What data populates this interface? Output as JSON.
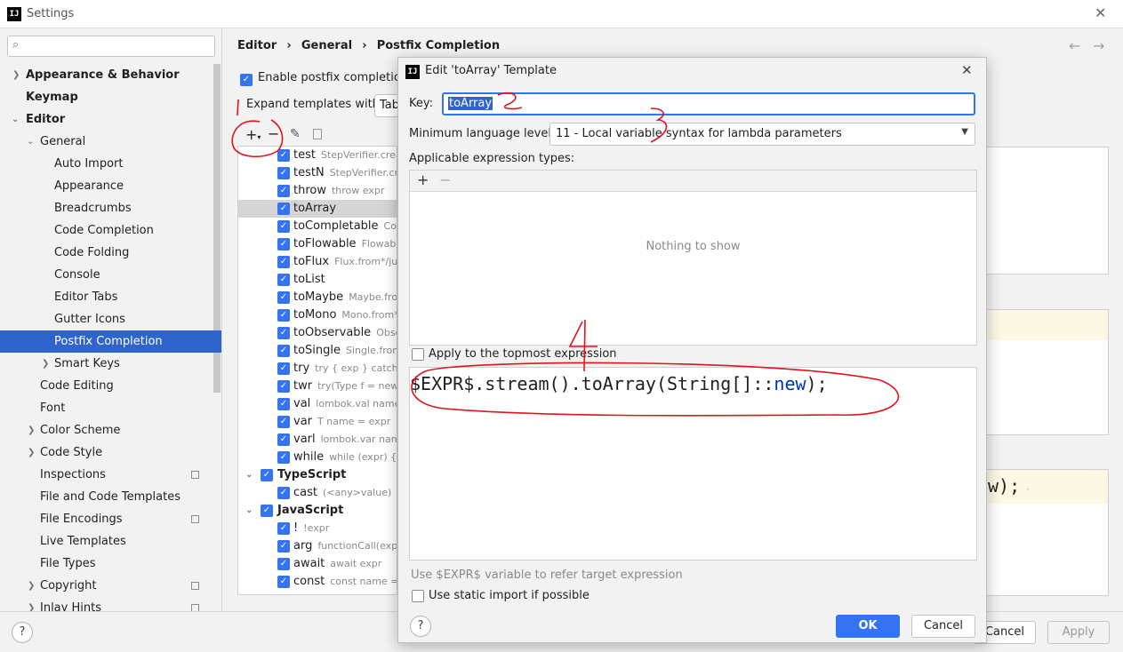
{
  "window": {
    "title": "Settings",
    "app_icon": "IJ"
  },
  "search": {
    "placeholder": ""
  },
  "sidebar": {
    "items": [
      {
        "label": "Appearance & Behavior"
      },
      {
        "label": "Keymap"
      },
      {
        "label": "Editor"
      },
      {
        "label": "General"
      },
      {
        "label": "Auto Import"
      },
      {
        "label": "Appearance"
      },
      {
        "label": "Breadcrumbs"
      },
      {
        "label": "Code Completion"
      },
      {
        "label": "Code Folding"
      },
      {
        "label": "Console"
      },
      {
        "label": "Editor Tabs"
      },
      {
        "label": "Gutter Icons"
      },
      {
        "label": "Postfix Completion"
      },
      {
        "label": "Smart Keys"
      },
      {
        "label": "Code Editing"
      },
      {
        "label": "Font"
      },
      {
        "label": "Color Scheme"
      },
      {
        "label": "Code Style"
      },
      {
        "label": "Inspections"
      },
      {
        "label": "File and Code Templates"
      },
      {
        "label": "File Encodings"
      },
      {
        "label": "Live Templates"
      },
      {
        "label": "File Types"
      },
      {
        "label": "Copyright"
      },
      {
        "label": "Inlay Hints"
      }
    ]
  },
  "breadcrumb": {
    "a": "Editor",
    "sep": "›",
    "b": "General",
    "c": "Postfix Completion"
  },
  "main": {
    "enable_label": "Enable postfix completion",
    "expand_label": "Expand templates with",
    "expand_value": "Tab",
    "preview_code_tail": "w);"
  },
  "templates": [
    {
      "key": "test",
      "desc": "StepVerifier.create"
    },
    {
      "key": "testN",
      "desc": "StepVerifier.create"
    },
    {
      "key": "throw",
      "desc": "throw expr"
    },
    {
      "key": "toArray",
      "desc": ""
    },
    {
      "key": "toCompletable",
      "desc": "Completable"
    },
    {
      "key": "toFlowable",
      "desc": "Flowable"
    },
    {
      "key": "toFlux",
      "desc": "Flux.from*/just"
    },
    {
      "key": "toList",
      "desc": ""
    },
    {
      "key": "toMaybe",
      "desc": "Maybe.from"
    },
    {
      "key": "toMono",
      "desc": "Mono.from*"
    },
    {
      "key": "toObservable",
      "desc": "Observable"
    },
    {
      "key": "toSingle",
      "desc": "Single.from*"
    },
    {
      "key": "try",
      "desc": "try { exp } catch(Ex"
    },
    {
      "key": "twr",
      "desc": "try(Type f = new T"
    },
    {
      "key": "val",
      "desc": "lombok.val name ="
    },
    {
      "key": "var",
      "desc": "T name = expr"
    },
    {
      "key": "varl",
      "desc": "lombok.var name"
    },
    {
      "key": "while",
      "desc": "while (expr) {}"
    },
    {
      "key": "TypeScript",
      "desc": "",
      "group": true
    },
    {
      "key": "cast",
      "desc": "(<any>value)"
    },
    {
      "key": "JavaScript",
      "desc": "",
      "group": true
    },
    {
      "key": "!",
      "desc": "!expr"
    },
    {
      "key": "arg",
      "desc": "functionCall(expr)"
    },
    {
      "key": "await",
      "desc": "await expr"
    },
    {
      "key": "const",
      "desc": "const name = e"
    }
  ],
  "dialog": {
    "title": "Edit 'toArray' Template",
    "key_label": "Key:",
    "key_value": "toArray",
    "min_level_label": "Minimum language level:",
    "min_level_value": "11 - Local variable syntax for lambda parameters",
    "types_label": "Applicable expression types:",
    "empty_text": "Nothing to show",
    "topmost_label": "Apply to the topmost expression",
    "code_prefix": "$EXPR$.stream().toArray(String[]::",
    "code_kw": "new",
    "code_suffix": ");",
    "hint": "Use $EXPR$ variable to refer target expression",
    "static_import_label": "Use static import if possible",
    "ok": "OK",
    "cancel": "Cancel"
  },
  "bottom": {
    "cancel": "Cancel",
    "apply": "Apply",
    "help": "?"
  },
  "annotations": [
    "1",
    "2",
    "3",
    "4"
  ]
}
